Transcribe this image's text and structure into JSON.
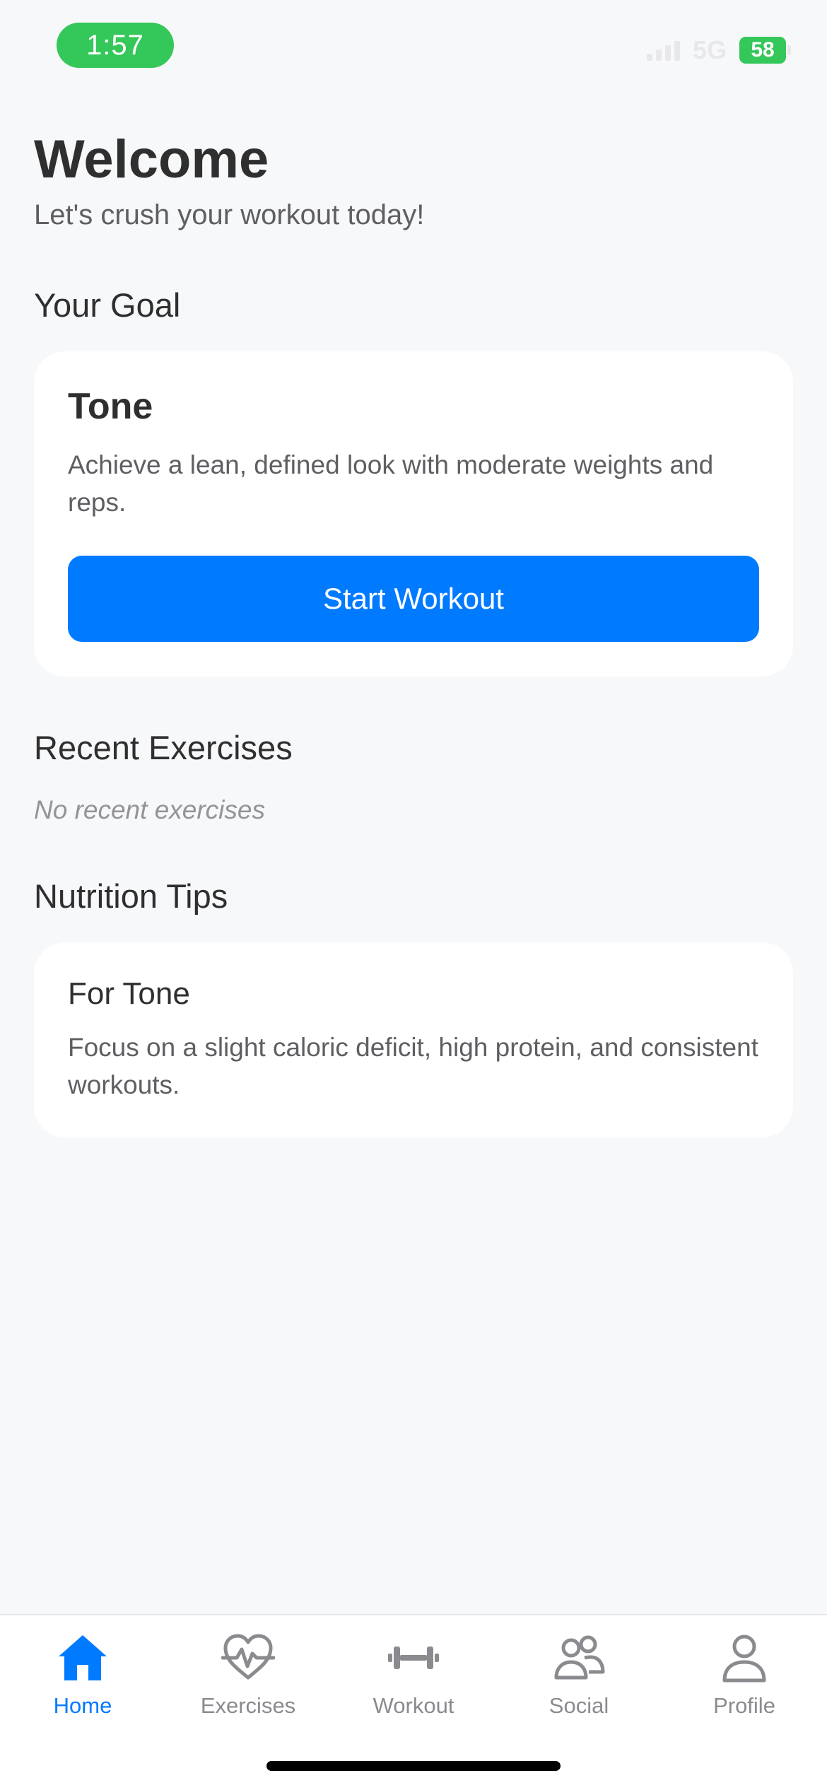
{
  "status_bar": {
    "time": "1:57",
    "network": "5G",
    "battery": "58"
  },
  "header": {
    "title": "Welcome",
    "subtitle": "Let's crush your workout today!"
  },
  "goal_section": {
    "heading": "Your Goal",
    "card": {
      "title": "Tone",
      "description": "Achieve a lean, defined look with moderate weights and reps.",
      "button_label": "Start Workout"
    }
  },
  "recent_section": {
    "heading": "Recent Exercises",
    "empty_text": "No recent exercises"
  },
  "nutrition_section": {
    "heading": "Nutrition Tips",
    "card": {
      "title": "For Tone",
      "description": "Focus on a slight caloric deficit, high protein, and consistent workouts."
    }
  },
  "tab_bar": {
    "items": [
      {
        "label": "Home",
        "icon": "house-icon",
        "active": true
      },
      {
        "label": "Exercises",
        "icon": "heart-pulse-icon",
        "active": false
      },
      {
        "label": "Workout",
        "icon": "dumbbell-icon",
        "active": false
      },
      {
        "label": "Social",
        "icon": "people-icon",
        "active": false
      },
      {
        "label": "Profile",
        "icon": "person-icon",
        "active": false
      }
    ]
  },
  "colors": {
    "accent": "#007aff",
    "background": "#f7f8fa",
    "card": "#ffffff",
    "status_green": "#34c759",
    "inactive_tab": "#8a8a8f"
  }
}
